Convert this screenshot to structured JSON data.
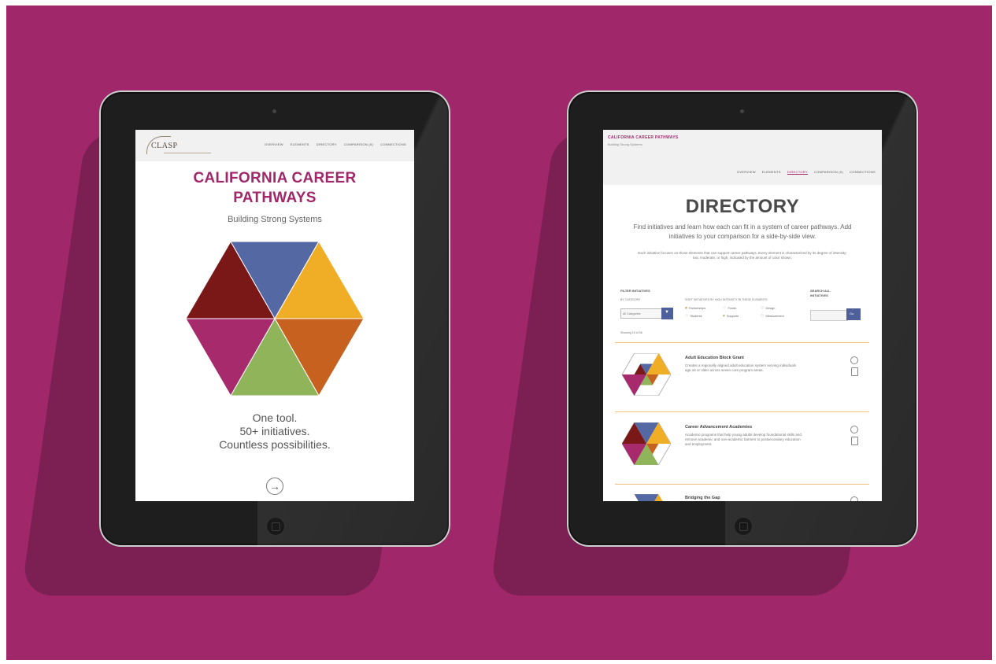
{
  "colors": {
    "background": "#a0286a",
    "brand": "#a0286a",
    "hex_dark_red": "#7a1818",
    "hex_blue": "#5468a3",
    "hex_gold": "#f0ae26",
    "hex_orange": "#c6611f",
    "hex_green": "#8fb45a",
    "hex_magenta": "#a72a6c",
    "button_blue": "#4e5f9a"
  },
  "left_screen": {
    "logo_text": "CLASP",
    "nav": [
      "OVERVIEW",
      "ELEMENTS",
      "DIRECTORY",
      "COMPARISON (0)",
      "CONNECTIONS"
    ],
    "title_line1": "CALIFORNIA CAREER",
    "title_line2": "PATHWAYS",
    "subtitle": "Building Strong Systems",
    "tagline": [
      "One tool.",
      "50+ initiatives.",
      "Countless possibilities."
    ]
  },
  "right_screen": {
    "brand": "CALIFORNIA CAREER PATHWAYS",
    "brand_sub": "Building Strong Systems",
    "nav": [
      "OVERVIEW",
      "ELEMENTS",
      "DIRECTORY",
      "COMPARISON (0)",
      "CONNECTIONS"
    ],
    "active_nav": "DIRECTORY",
    "heading": "DIRECTORY",
    "intro": "Find initiatives and learn how each can fit in a system of career pathways. Add initiatives to your comparison for a side-by-side view.",
    "note": "Each initiative focuses on those elements that can support career pathways. Every element is characterized by its degree of intensity: low, moderate, or high, indicated by the amount of color shown.",
    "filter_label": "FILTER INITIATIVES",
    "by_category": "BY CATEGORY",
    "category_value": "All Categories",
    "element_hint": "SORT INITIATIVES BY HIGH INTENSITY IN THESE ELEMENTS:",
    "elements": [
      "Partnerships",
      "Students",
      "Funds",
      "Supports",
      "Design",
      "Measurement"
    ],
    "search_label_1": "SEARCH ALL",
    "search_label_2": "INITIATIVES",
    "search_button": "Go",
    "showing": "Showing 15 of 56",
    "cards": [
      {
        "title": "Adult Education Block Grant",
        "desc": "Creates a regionally aligned adult education system serving individuals age 16 or older across seven core program areas."
      },
      {
        "title": "Career Advancement Academies",
        "desc": "Academic programs that help young adults develop foundational skills and remove academic and non-academic barriers to postsecondary education and employment."
      },
      {
        "title": "Bridging the Gap",
        "desc": ""
      }
    ]
  }
}
